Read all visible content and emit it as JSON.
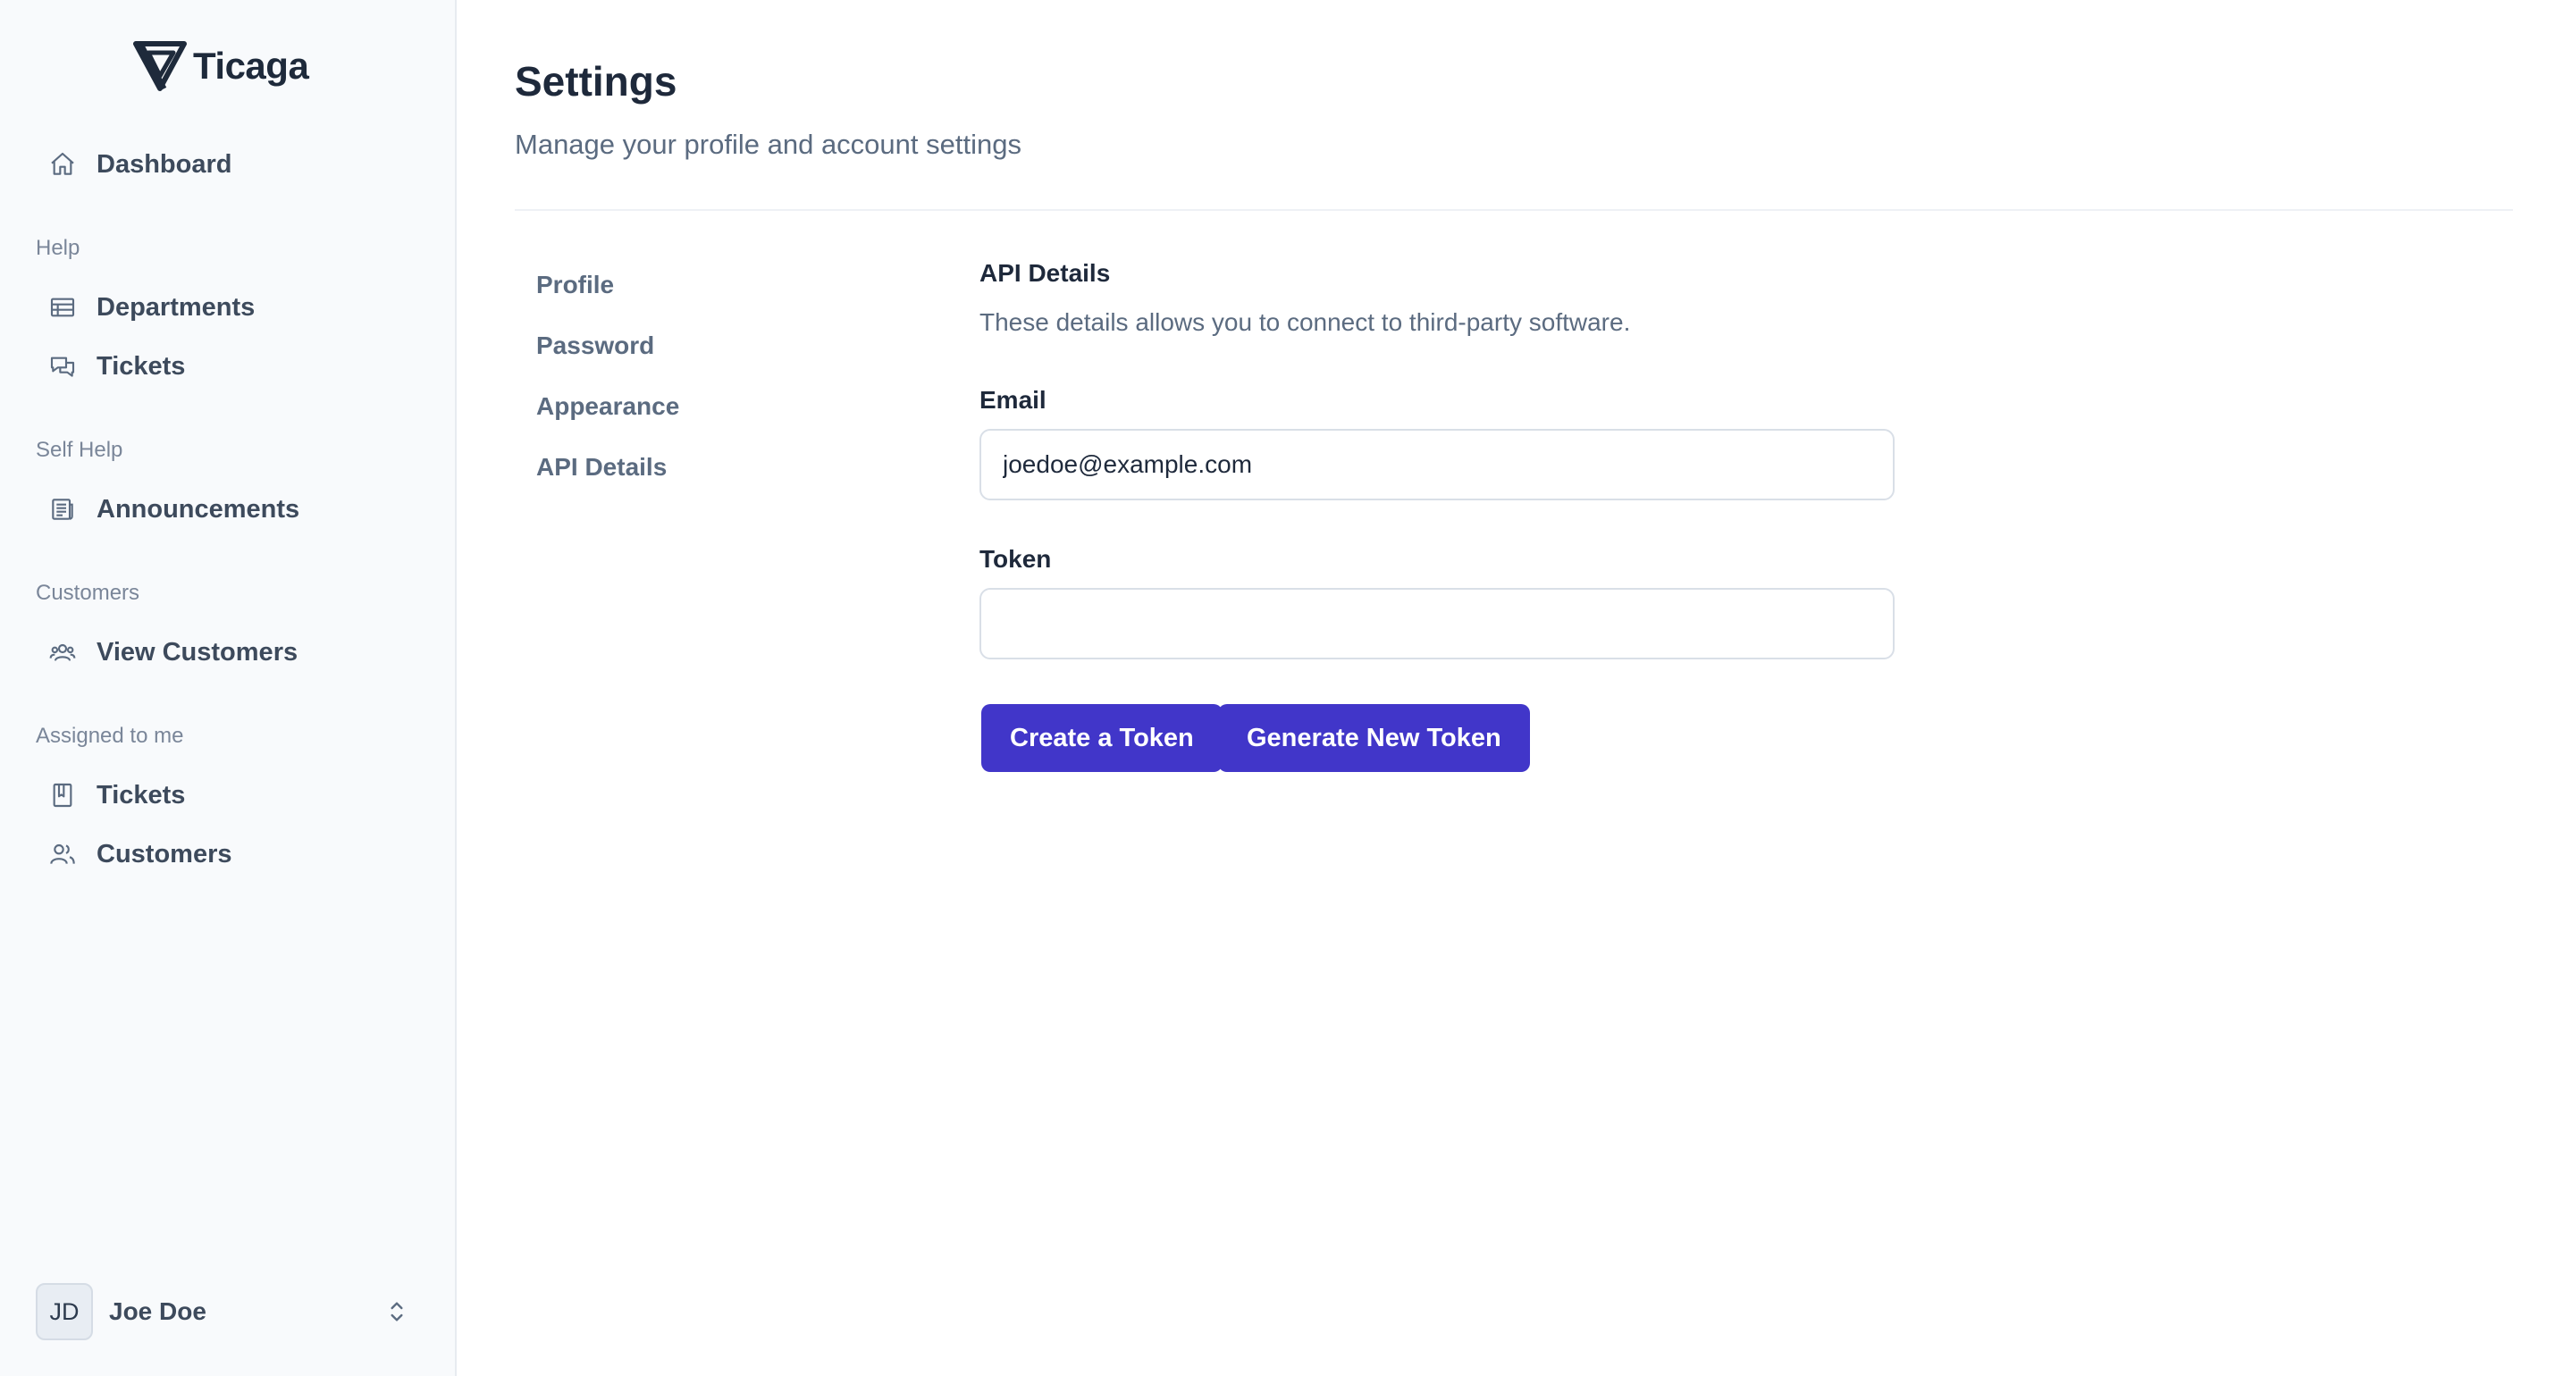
{
  "brand": {
    "name": "Ticaga",
    "accent": "#1e2a3b"
  },
  "sidebar": {
    "dashboard": {
      "label": "Dashboard",
      "icon": "home-icon"
    },
    "groups": [
      {
        "title": "Help",
        "items": [
          {
            "label": "Departments",
            "icon": "table-icon"
          },
          {
            "label": "Tickets",
            "icon": "chat-bubbles-icon"
          }
        ]
      },
      {
        "title": "Self Help",
        "items": [
          {
            "label": "Announcements",
            "icon": "newspaper-icon"
          }
        ]
      },
      {
        "title": "Customers",
        "items": [
          {
            "label": "View Customers",
            "icon": "user-group-icon"
          }
        ]
      },
      {
        "title": "Assigned to me",
        "items": [
          {
            "label": "Tickets",
            "icon": "book-icon"
          },
          {
            "label": "Customers",
            "icon": "users-icon"
          }
        ]
      }
    ],
    "user": {
      "initials": "JD",
      "name": "Joe Doe"
    }
  },
  "page": {
    "title": "Settings",
    "subtitle": "Manage your profile and account settings"
  },
  "settings_nav": [
    "Profile",
    "Password",
    "Appearance",
    "API Details"
  ],
  "api": {
    "title": "API Details",
    "description": "These details allows you to connect to third-party software.",
    "email_label": "Email",
    "email_value": "joedoe@example.com",
    "token_label": "Token",
    "token_value": "",
    "create_button": "Create a Token",
    "generate_button": "Generate New Token"
  },
  "colors": {
    "primary": "#4136c9",
    "sidebar_bg": "#f8fafc"
  }
}
